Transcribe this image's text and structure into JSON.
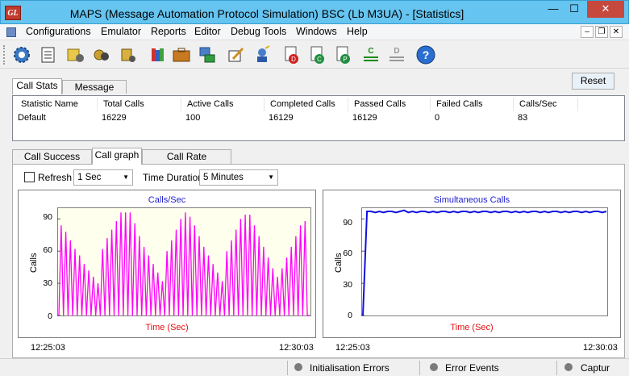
{
  "window": {
    "title": "MAPS (Message Automation Protocol Simulation) BSC (Lb  M3UA) - [Statistics]",
    "logo_text": "GL",
    "minimize_glyph": "—",
    "maximize_glyph": "☐",
    "close_glyph": "✕"
  },
  "menu": {
    "items": [
      "Configurations",
      "Emulator",
      "Reports",
      "Editor",
      "Debug Tools",
      "Windows",
      "Help"
    ],
    "mdi_min": "–",
    "mdi_restore": "❐",
    "mdi_close": "✕"
  },
  "toolbar": {
    "icons": [
      "gear-icon",
      "log-icon",
      "scripts-icon",
      "profiles-icon",
      "messages-icon",
      "books-icon",
      "briefcase-icon",
      "network-icon",
      "edit-icon",
      "wizard-icon",
      "call-generation-icon",
      "call-receive-icon",
      "pause-icon",
      "connect-icon",
      "disconnect-icon",
      "help-icon"
    ]
  },
  "stats": {
    "tabs": [
      "Call Stats",
      "Message Stats"
    ],
    "active_tab": "Call Stats",
    "reset_label": "Reset",
    "columns": [
      "Statistic Name",
      "Total Calls",
      "Active Calls",
      "Completed Calls",
      "Passed Calls",
      "Failed Calls",
      "Calls/Sec"
    ],
    "rows": [
      [
        "Default",
        "16229",
        "100",
        "16129",
        "16129",
        "0",
        "83"
      ]
    ]
  },
  "graph_tabs": [
    "Call Success Ratio",
    "Call graph",
    "Call Rate Distribution"
  ],
  "active_graph_tab": "Call graph",
  "controls": {
    "refresh_label": "Refresh",
    "refresh_checked": false,
    "interval_value": "1 Sec",
    "duration_label": "Time Duration",
    "duration_value": "5 Minutes"
  },
  "chart_data": [
    {
      "type": "line",
      "title": "Calls/Sec",
      "xlabel": "Time (Sec)",
      "ylabel": "Calls",
      "ylim": [
        0,
        100
      ],
      "yticks": [
        0,
        30,
        60,
        90
      ],
      "x_start": "12:25:03",
      "x_end": "12:30:03",
      "color": "#ff00ff",
      "grid": false,
      "series": [
        {
          "values": [
            0,
            84,
            0,
            78,
            0,
            70,
            0,
            62,
            0,
            56,
            0,
            48,
            0,
            42,
            0,
            36,
            0,
            30,
            0,
            62,
            0,
            72,
            0,
            80,
            0,
            88,
            0,
            96,
            0,
            96,
            0,
            96,
            0,
            86,
            0,
            74,
            0,
            64,
            0,
            56,
            0,
            48,
            0,
            40,
            0,
            32,
            0,
            60,
            0,
            70,
            0,
            80,
            0,
            90,
            0,
            96,
            0,
            92,
            0,
            84,
            0,
            74,
            0,
            64,
            0,
            56,
            0,
            48,
            0,
            40,
            0,
            32,
            0,
            60,
            0,
            70,
            0,
            80,
            0,
            90,
            0,
            94,
            0,
            94,
            0,
            84,
            0,
            74,
            0,
            64,
            0,
            54,
            0,
            44,
            0,
            36,
            0,
            44,
            0,
            54,
            0,
            64,
            0,
            74,
            0,
            84,
            0,
            88,
            0,
            0
          ]
        }
      ]
    },
    {
      "type": "line",
      "title": "Simultaneous Calls",
      "xlabel": "Time (Sec)",
      "ylabel": "Calls",
      "ylim": [
        0,
        100
      ],
      "yticks": [
        0,
        30,
        60,
        90
      ],
      "x_start": "12:25:03",
      "x_end": "12:30:03",
      "color": "#1010e0",
      "grid": false,
      "series": [
        {
          "values": [
            0,
            97,
            97,
            96,
            97,
            96,
            97,
            97,
            96,
            97,
            98,
            96,
            97,
            96,
            97,
            97,
            96,
            97,
            96,
            97,
            97,
            96,
            97,
            96,
            97,
            97,
            96,
            97,
            96,
            97,
            97,
            96,
            97,
            96,
            97,
            97,
            96,
            97,
            96,
            97,
            96,
            97,
            97,
            96,
            97,
            96,
            97,
            97,
            96,
            97,
            96,
            97,
            97,
            96,
            97,
            96,
            97,
            97,
            96,
            97
          ]
        }
      ]
    }
  ],
  "statusbar": {
    "panels": [
      "Initialisation Errors",
      "Error Events",
      "Captur"
    ]
  }
}
